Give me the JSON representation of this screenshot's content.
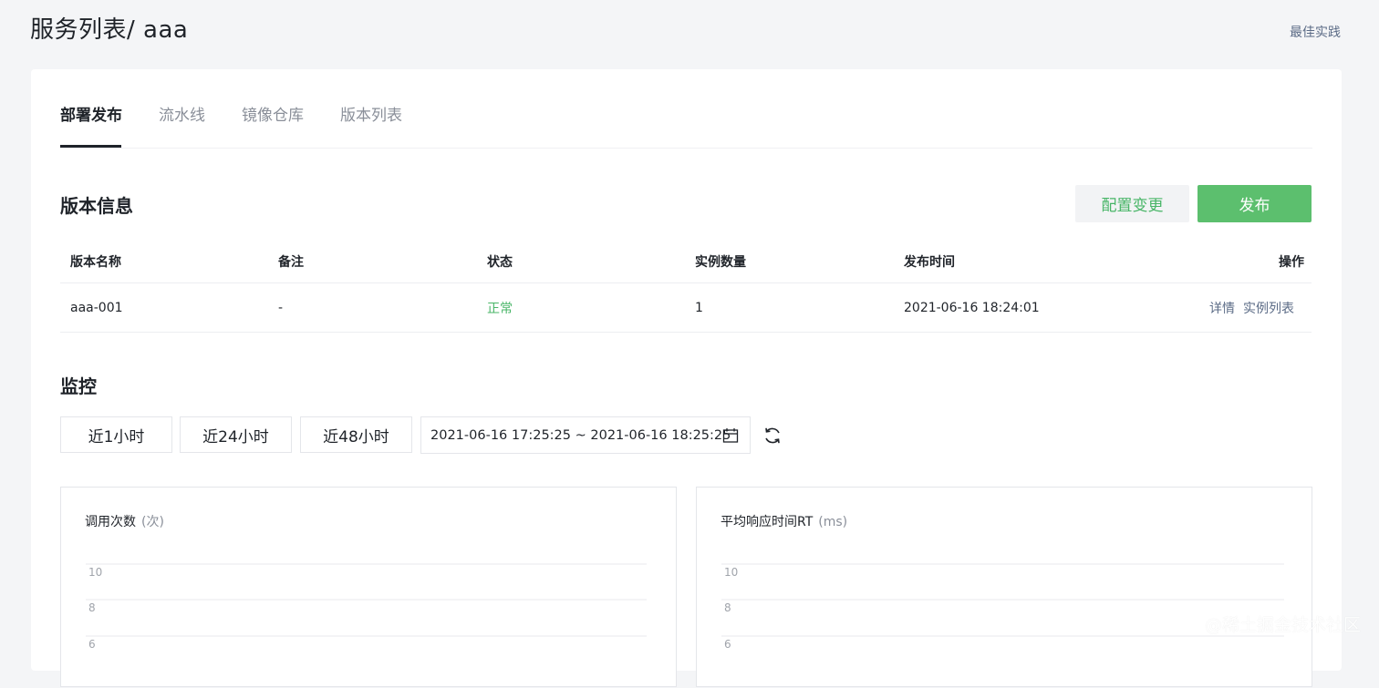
{
  "header": {
    "title": "服务列表/ aaa",
    "best_practice": "最佳实践"
  },
  "tabs": [
    {
      "label": "部署发布",
      "active": true
    },
    {
      "label": "流水线",
      "active": false
    },
    {
      "label": "镜像仓库",
      "active": false
    },
    {
      "label": "版本列表",
      "active": false
    }
  ],
  "version_section": {
    "title": "版本信息",
    "config_change_label": "配置变更",
    "publish_label": "发布",
    "columns": [
      "版本名称",
      "备注",
      "状态",
      "实例数量",
      "发布时间",
      "操作"
    ],
    "rows": [
      {
        "name": "aaa-001",
        "remark": "-",
        "status": "正常",
        "instances": "1",
        "published_at": "2021-06-16 18:24:01",
        "actions": [
          "详情",
          "实例列表"
        ]
      }
    ]
  },
  "monitor_section": {
    "title": "监控",
    "ranges": [
      "近1小时",
      "近24小时",
      "近48小时"
    ],
    "date_range": "2021-06-16 17:25:25 ~ 2021-06-16 18:25:25",
    "charts": [
      {
        "title": "调用次数",
        "unit": "(次)",
        "y_ticks": [
          "10",
          "8",
          "6"
        ]
      },
      {
        "title": "平均响应时间RT",
        "unit": "(ms)",
        "y_ticks": [
          "10",
          "8",
          "6"
        ]
      }
    ]
  },
  "colors": {
    "accent_green": "#5cbf6e",
    "status_green": "#48b567",
    "link": "#5b6b86"
  },
  "watermark": "@稀土掘金技术社区"
}
